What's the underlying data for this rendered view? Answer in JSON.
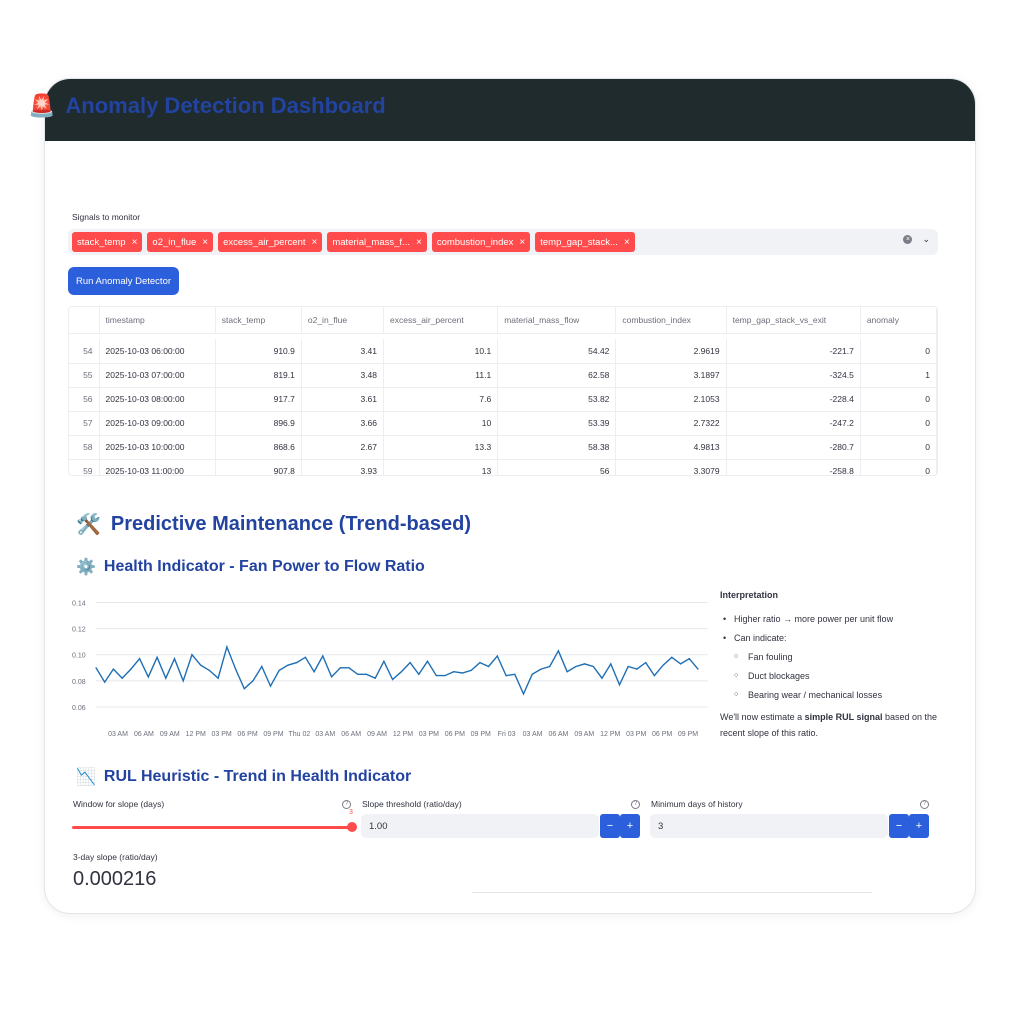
{
  "header": {
    "title": "Anomaly Detection Dashboard",
    "title_emoji": "🚨"
  },
  "signals": {
    "label": "Signals to monitor",
    "chips": [
      "stack_temp",
      "o2_in_flue",
      "excess_air_percent",
      "material_mass_f...",
      "combustion_index",
      "temp_gap_stack..."
    ]
  },
  "run_button": "Run Anomaly Detector",
  "table": {
    "columns": [
      "",
      "timestamp",
      "stack_temp",
      "o2_in_flue",
      "excess_air_percent",
      "material_mass_flow",
      "combustion_index",
      "temp_gap_stack_vs_exit",
      "anomaly"
    ],
    "rows": [
      [
        "54",
        "2025-10-03 06:00:00",
        "910.9",
        "3.41",
        "10.1",
        "54.42",
        "2.9619",
        "-221.7",
        "0"
      ],
      [
        "55",
        "2025-10-03 07:00:00",
        "819.1",
        "3.48",
        "11.1",
        "62.58",
        "3.1897",
        "-324.5",
        "1"
      ],
      [
        "56",
        "2025-10-03 08:00:00",
        "917.7",
        "3.61",
        "7.6",
        "53.82",
        "2.1053",
        "-228.4",
        "0"
      ],
      [
        "57",
        "2025-10-03 09:00:00",
        "896.9",
        "3.66",
        "10",
        "53.39",
        "2.7322",
        "-247.2",
        "0"
      ],
      [
        "58",
        "2025-10-03 10:00:00",
        "868.6",
        "2.67",
        "13.3",
        "58.38",
        "4.9813",
        "-280.7",
        "0"
      ],
      [
        "59",
        "2025-10-03 11:00:00",
        "907.8",
        "3.93",
        "13",
        "56",
        "3.3079",
        "-258.8",
        "0"
      ]
    ]
  },
  "pm": {
    "title": "Predictive Maintenance (Trend-based)",
    "emoji": "🛠️"
  },
  "health": {
    "title": "Health Indicator - Fan Power to Flow Ratio",
    "emoji": "⚙️"
  },
  "chart_data": {
    "type": "line",
    "title": "",
    "xlabel": "",
    "ylabel": "",
    "ylim": [
      0.05,
      0.145
    ],
    "yticks": [
      "0.14",
      "0.12",
      "0.10",
      "0.08",
      "0.06"
    ],
    "ytick_values": [
      0.14,
      0.12,
      0.1,
      0.08,
      0.06
    ],
    "xticks": [
      "03 AM",
      "06 AM",
      "09 AM",
      "12 PM",
      "03 PM",
      "06 PM",
      "09 PM",
      "Thu 02",
      "03 AM",
      "06 AM",
      "09 AM",
      "12 PM",
      "03 PM",
      "06 PM",
      "09 PM",
      "Fri 03",
      "03 AM",
      "06 AM",
      "09 AM",
      "12 PM",
      "03 PM",
      "06 PM",
      "09 PM"
    ],
    "grid": true,
    "color": "#1f6fb5",
    "values": [
      0.09,
      0.079,
      0.089,
      0.082,
      0.089,
      0.097,
      0.083,
      0.098,
      0.082,
      0.097,
      0.08,
      0.1,
      0.092,
      0.088,
      0.082,
      0.106,
      0.089,
      0.074,
      0.08,
      0.091,
      0.076,
      0.088,
      0.092,
      0.094,
      0.098,
      0.087,
      0.099,
      0.083,
      0.09,
      0.09,
      0.085,
      0.085,
      0.082,
      0.095,
      0.081,
      0.087,
      0.094,
      0.085,
      0.095,
      0.084,
      0.084,
      0.087,
      0.086,
      0.088,
      0.094,
      0.091,
      0.099,
      0.084,
      0.085,
      0.07,
      0.085,
      0.089,
      0.091,
      0.103,
      0.087,
      0.091,
      0.093,
      0.091,
      0.082,
      0.093,
      0.077,
      0.091,
      0.089,
      0.094,
      0.084,
      0.092,
      0.098,
      0.093,
      0.097,
      0.089
    ]
  },
  "interpretation": {
    "title": "Interpretation",
    "bullets": [
      "Higher ratio → more power per unit flow",
      "Can indicate:"
    ],
    "sub_bullets": [
      "Fan fouling",
      "Duct blockages",
      "Bearing wear / mechanical losses"
    ],
    "note_prefix": "We'll now estimate a ",
    "note_bold": "simple RUL signal",
    "note_suffix": " based on the recent slope of this ratio."
  },
  "rul": {
    "title": "RUL Heuristic - Trend in Health Indicator",
    "emoji": "📉",
    "window_label": "Window for slope (days)",
    "window_value": "3",
    "threshold_label": "Slope threshold (ratio/day)",
    "threshold_value": "1.00",
    "min_days_label": "Minimum days of history",
    "min_days_value": "3",
    "metric_label": "3-day slope (ratio/day)",
    "metric_value": "0.000216"
  },
  "buttons": {
    "minus": "−",
    "plus": "+"
  }
}
